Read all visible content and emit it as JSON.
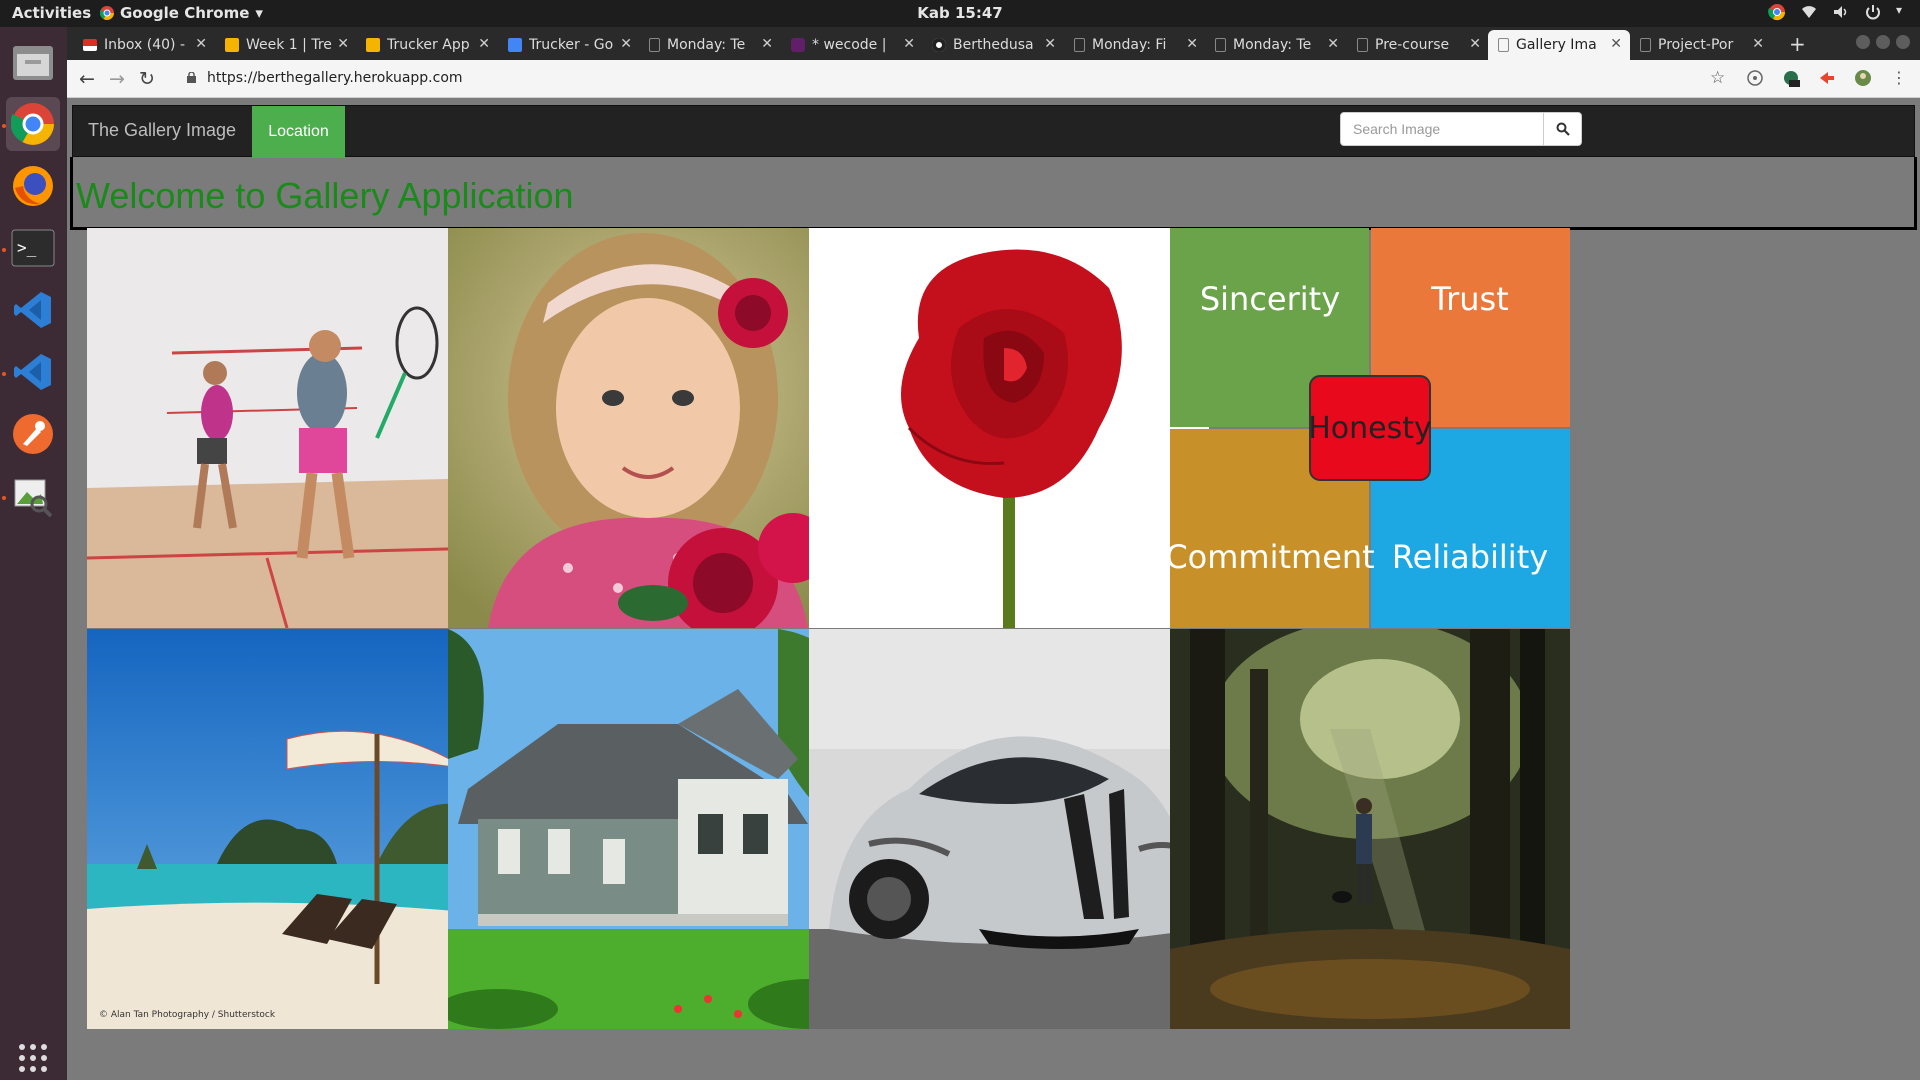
{
  "system": {
    "activities": "Activities",
    "app_name": "Google Chrome",
    "clock": "Kab 15:47"
  },
  "browser": {
    "tabs": [
      {
        "label": "Inbox (40) -",
        "favicon": "gmail-icon"
      },
      {
        "label": "Week 1 | Tre",
        "favicon": "slides-icon"
      },
      {
        "label": "Trucker App",
        "favicon": "slides-icon"
      },
      {
        "label": "Trucker - Go",
        "favicon": "docs-icon"
      },
      {
        "label": "Monday: Te",
        "favicon": "page-icon"
      },
      {
        "label": "* wecode | ",
        "favicon": "slack-icon"
      },
      {
        "label": "Berthedusa",
        "favicon": "github-icon"
      },
      {
        "label": "Monday: Fi",
        "favicon": "page-icon"
      },
      {
        "label": "Monday: Te",
        "favicon": "page-icon"
      },
      {
        "label": "Pre-course",
        "favicon": "page-icon"
      },
      {
        "label": "Gallery Ima",
        "favicon": "page-icon"
      },
      {
        "label": "Project-Por",
        "favicon": "page-icon"
      }
    ],
    "active_tab_index": 10,
    "url": "https://berthegallery.herokuapp.com"
  },
  "site": {
    "brand": "The Gallery Image",
    "nav_location": "Location",
    "search_placeholder": "Search Image",
    "heading": "Welcome to Gallery Application",
    "accent_color": "#4cae4c",
    "heading_color": "#1a8a1a",
    "images": [
      {
        "subject": "squash players"
      },
      {
        "subject": "girl with flowers"
      },
      {
        "subject": "red rose"
      },
      {
        "subject": "values quadrant",
        "words": [
          "Sincerity",
          "Trust",
          "Honesty",
          "Commitment",
          "Reliability"
        ]
      },
      {
        "subject": "beach umbrella",
        "credit": "© Alan Tan Photography / Shutterstock"
      },
      {
        "subject": "house"
      },
      {
        "subject": "sports car"
      },
      {
        "subject": "forest walk"
      }
    ]
  }
}
